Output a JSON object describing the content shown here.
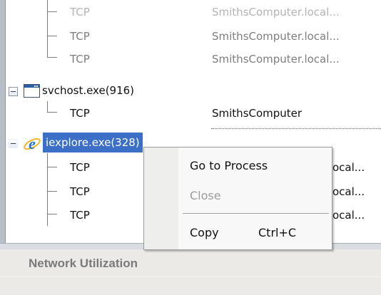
{
  "tree": {
    "rows_top": [
      {
        "protocol": "TCP",
        "host": "SmithsComputer.local..."
      },
      {
        "protocol": "TCP",
        "host": "SmithsComputer.local..."
      },
      {
        "protocol": "TCP",
        "host": "SmithsComputer.local..."
      }
    ],
    "svchost": {
      "process": "svchost.exe(916)",
      "child": {
        "protocol": "TCP",
        "host": "SmithsComputer"
      }
    },
    "iexplore": {
      "process": "iexplore.exe(328)",
      "children": [
        {
          "protocol": "TCP",
          "host_tail": "ocal..."
        },
        {
          "protocol": "TCP",
          "host_tail": "ocal..."
        },
        {
          "protocol": "TCP",
          "host_tail": "ocal..."
        }
      ]
    }
  },
  "context_menu": {
    "go_to_process": "Go to Process",
    "close": "Close",
    "copy": "Copy",
    "copy_shortcut": "Ctrl+C"
  },
  "footer": {
    "title": "Network Utilization"
  },
  "colors": {
    "selection": "#3b6fc8",
    "ie_icon": "#1e73d8"
  }
}
